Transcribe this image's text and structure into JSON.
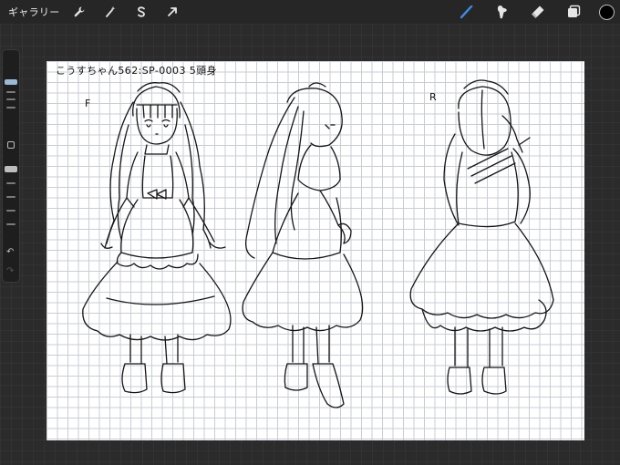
{
  "topbar": {
    "gallery_label": "ギャラリー",
    "left_tools": [
      {
        "name": "wrench-icon"
      },
      {
        "name": "magic-wand-icon"
      },
      {
        "name": "selection-s-icon"
      },
      {
        "name": "transform-arrow-icon"
      }
    ],
    "right_tools": [
      {
        "name": "brush-icon",
        "active": true
      },
      {
        "name": "smudge-icon"
      },
      {
        "name": "eraser-icon"
      },
      {
        "name": "layers-icon"
      }
    ],
    "current_color": "#000000",
    "active_color": "#3a8ee6"
  },
  "canvas": {
    "note": "こうすちゃん562:SP-0003 5頭身",
    "front_label": "F",
    "back_label": "R"
  }
}
